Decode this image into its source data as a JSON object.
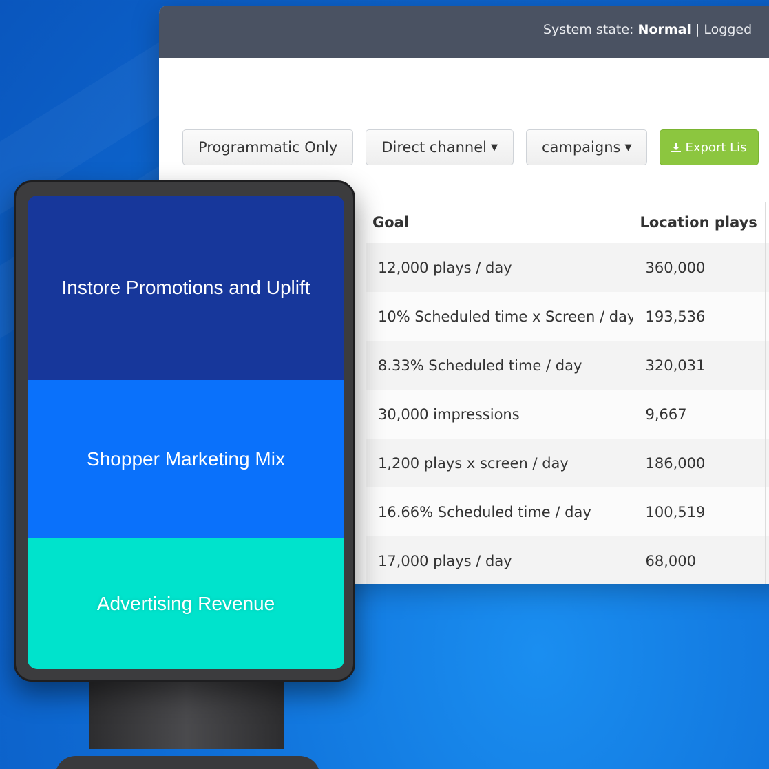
{
  "header": {
    "status_prefix": "System state: ",
    "status_value": "Normal",
    "status_suffix": " | Logged"
  },
  "toolbar": {
    "programmatic_label": "Programmatic Only",
    "direct_channel_label": "Direct channel",
    "campaigns_label": "campaigns",
    "export_label": "Export Lis"
  },
  "table": {
    "columns": [
      "Goal",
      "Location plays"
    ],
    "rows": [
      {
        "goal": "12,000 plays / day",
        "plays": "360,000"
      },
      {
        "goal": "10% Scheduled time x Screen / day",
        "plays": "193,536"
      },
      {
        "goal": "8.33% Scheduled time / day",
        "plays": "320,031"
      },
      {
        "goal": "30,000 impressions",
        "plays": "9,667"
      },
      {
        "goal": "1,200 plays x screen / day",
        "plays": "186,000"
      },
      {
        "goal": "16.66% Scheduled time / day",
        "plays": "100,519"
      },
      {
        "goal": "17,000 plays / day",
        "plays": "68,000"
      }
    ]
  },
  "kiosk": {
    "panels": [
      {
        "label": "Instore Promotions and Uplift",
        "color": "#17379b"
      },
      {
        "label": "Shopper Marketing Mix",
        "color": "#0a71fb"
      },
      {
        "label": "Advertising Revenue",
        "color": "#00e3cc"
      }
    ]
  },
  "colors": {
    "topbar": "#4a5262",
    "export_button": "#8cc63f",
    "background": "#0f6fd8"
  }
}
